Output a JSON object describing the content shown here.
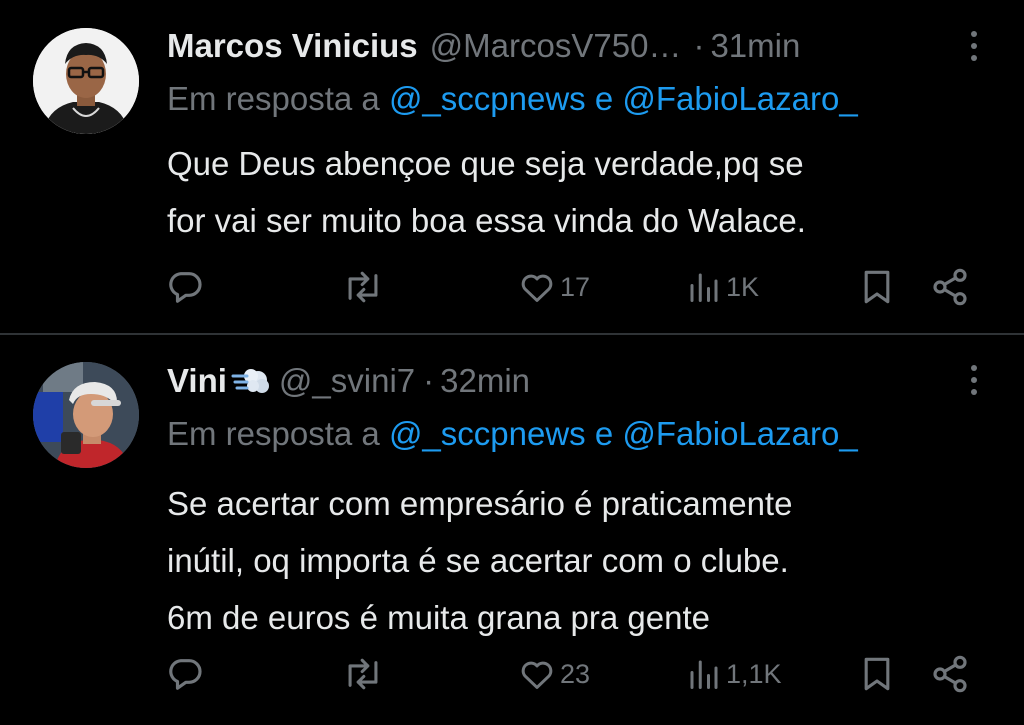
{
  "tweets": [
    {
      "name": "Marcos Vinicius",
      "handle": "@MarcosV750…",
      "dot": "·",
      "time": "31min",
      "reply_prefix": "Em resposta a",
      "mention1": "@_sccpnews",
      "reply_and": "e",
      "mention2": "@FabioLazaro_",
      "text_lines": [
        "Que Deus abençoe que seja verdade,pq se",
        "for vai ser muito boa essa vinda do Walace."
      ],
      "likes": "17",
      "views": "1K",
      "icons": [
        "reply-icon",
        "retweet-icon",
        "heart-icon",
        "views-icon",
        "bookmark-icon",
        "share-icon",
        "more-icon"
      ]
    },
    {
      "name": "Vini",
      "handle": "@_svini7",
      "dot": "·",
      "time": "32min",
      "badge": "dash-emoji",
      "reply_prefix": "Em resposta a",
      "mention1": "@_sccpnews",
      "reply_and": "e",
      "mention2": "@FabioLazaro_",
      "text_lines": [
        "Se acertar com empresário é praticamente",
        "inútil, oq importa é se acertar com o clube.",
        "6m de euros é muita grana pra gente"
      ],
      "likes": "23",
      "views": "1,1K",
      "icons": [
        "reply-icon",
        "retweet-icon",
        "heart-icon",
        "views-icon",
        "bookmark-icon",
        "share-icon",
        "more-icon"
      ]
    }
  ],
  "colors": {
    "background": "#000000",
    "text": "#e7e9ea",
    "muted": "#71767b",
    "link": "#1d9bf0",
    "divider": "#2f3336"
  }
}
